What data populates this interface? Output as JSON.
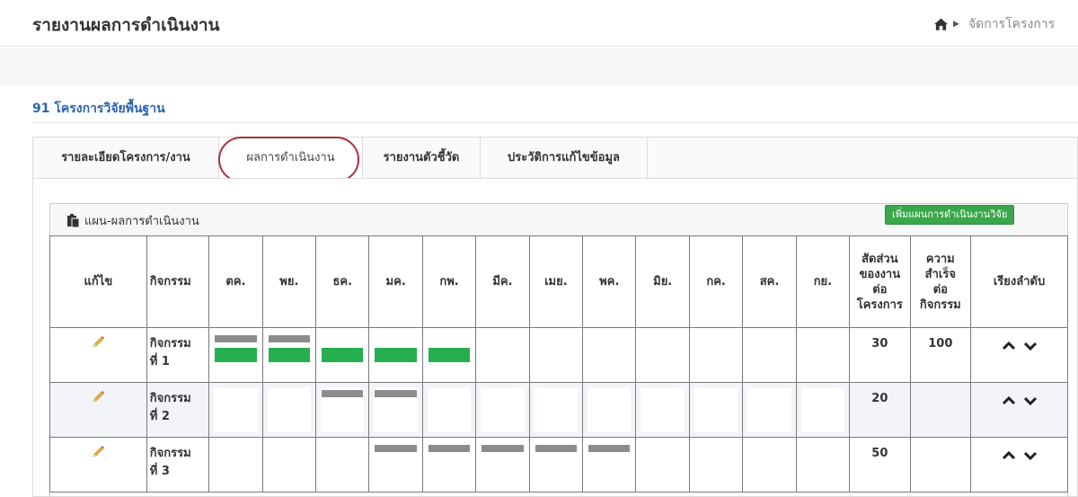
{
  "header": {
    "title": "รายงานผลการดำเนินงาน",
    "breadcrumb_item": "จัดการโครงการ"
  },
  "project": {
    "title": "91 โครงการวิจัยพื้นฐาน"
  },
  "tabs": [
    {
      "label": "รายละเอียดโครงการ/งาน",
      "active": false
    },
    {
      "label": "ผลการดำเนินงาน",
      "active": true
    },
    {
      "label": "รายงานตัวชี้วัด",
      "active": false
    },
    {
      "label": "ประวัติการแก้ไขข้อมูล",
      "active": false
    }
  ],
  "panel": {
    "title": "แผน-ผลการดำเนินงาน",
    "add_button": "เพิ่มแผนการดำเนินงานวิจัย"
  },
  "table": {
    "col_edit": "แก้ไข",
    "col_activity": "กิจกรรม",
    "months": [
      "ตค.",
      "พย.",
      "ธค.",
      "มค.",
      "กพ.",
      "มีค.",
      "เมย.",
      "พค.",
      "มิย.",
      "กค.",
      "สค.",
      "กย."
    ],
    "col_share_l1": "สัดส่วน",
    "col_share_l2": "ของงาน",
    "col_share_l3": "ต่อ",
    "col_share_l4": "โครงการ",
    "col_success_l1": "ความ",
    "col_success_l2": "สำเร็จ",
    "col_success_l3": "ต่อ",
    "col_success_l4": "กิจกรรม",
    "col_order": "เรียงลำดับ",
    "rows": [
      {
        "name_l1": "กิจกรรม",
        "name_l2": "ที่ 1",
        "plan": [
          1,
          1,
          0,
          0,
          0,
          0,
          0,
          0,
          0,
          0,
          0,
          0
        ],
        "actual": [
          1,
          1,
          1,
          1,
          1,
          0,
          0,
          0,
          0,
          0,
          0,
          0
        ],
        "share": "30",
        "success": "100"
      },
      {
        "name_l1": "กิจกรรม",
        "name_l2": "ที่ 2",
        "plan": [
          0,
          0,
          1,
          1,
          0,
          0,
          0,
          0,
          0,
          0,
          0,
          0
        ],
        "actual": [
          0,
          0,
          0,
          0,
          0,
          0,
          0,
          0,
          0,
          0,
          0,
          0
        ],
        "share": "20",
        "success": ""
      },
      {
        "name_l1": "กิจกรรม",
        "name_l2": "ที่ 3",
        "plan": [
          0,
          0,
          0,
          1,
          1,
          1,
          1,
          1,
          0,
          0,
          0,
          0
        ],
        "actual": [
          0,
          0,
          0,
          0,
          0,
          0,
          0,
          0,
          0,
          0,
          0,
          0
        ],
        "share": "50",
        "success": ""
      }
    ]
  },
  "colors": {
    "plan_bar": "#8c8c8c",
    "actual_bar": "#27ae4f",
    "project_link": "#2a62b3",
    "add_button": "#3aa74a",
    "active_tab_ring": "#a8323c"
  },
  "icons": {
    "home": "home-icon",
    "breadcrumb_separator": "caret-right-icon",
    "panel": "clipboard-icon",
    "edit": "pencil-icon",
    "move_up": "chevron-up-icon",
    "move_down": "chevron-down-icon"
  }
}
